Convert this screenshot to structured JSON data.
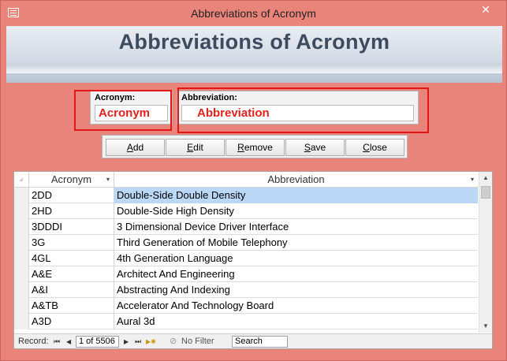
{
  "window": {
    "title": "Abbreviations of Acronym",
    "close_glyph": "✕"
  },
  "header": {
    "title": "Abbreviations of Acronym"
  },
  "fields": {
    "acronym": {
      "label": "Acronym:",
      "value": "Acronym"
    },
    "abbreviation": {
      "label": "Abbreviation:",
      "value": "Abbreviation"
    }
  },
  "buttons": {
    "add": {
      "ul": "A",
      "rest": "dd"
    },
    "edit": {
      "ul": "E",
      "rest": "dit"
    },
    "remove": {
      "ul": "R",
      "rest": "emove"
    },
    "save": {
      "ul": "S",
      "rest": "ave"
    },
    "close": {
      "ul": "C",
      "rest": "lose"
    }
  },
  "grid": {
    "columns": [
      "Acronym",
      "Abbreviation"
    ],
    "dropdown_glyph": "▾",
    "rows": [
      {
        "acronym": "2DD",
        "abbreviation": "Double-Side Double Density"
      },
      {
        "acronym": "2HD",
        "abbreviation": "Double-Side High Density"
      },
      {
        "acronym": "3DDDI",
        "abbreviation": "3 Dimensional Device Driver Interface"
      },
      {
        "acronym": "3G",
        "abbreviation": "Third Generation of Mobile Telephony"
      },
      {
        "acronym": "4GL",
        "abbreviation": "4th Generation Language"
      },
      {
        "acronym": "A&E",
        "abbreviation": "Architect And Engineering"
      },
      {
        "acronym": "A&I",
        "abbreviation": "Abstracting And Indexing"
      },
      {
        "acronym": "A&TB",
        "abbreviation": "Accelerator And Technology Board"
      },
      {
        "acronym": "A3D",
        "abbreviation": "Aural 3d"
      }
    ]
  },
  "navigation": {
    "record_label": "Record:",
    "first_glyph": "⏮",
    "prev_glyph": "◀",
    "position": "1 of 5506",
    "next_glyph": "▶",
    "last_glyph": "⏭",
    "new_glyph": "▶✱",
    "filter_icon": "⊘",
    "filter_label": "No Filter",
    "search_label": "Search"
  }
}
